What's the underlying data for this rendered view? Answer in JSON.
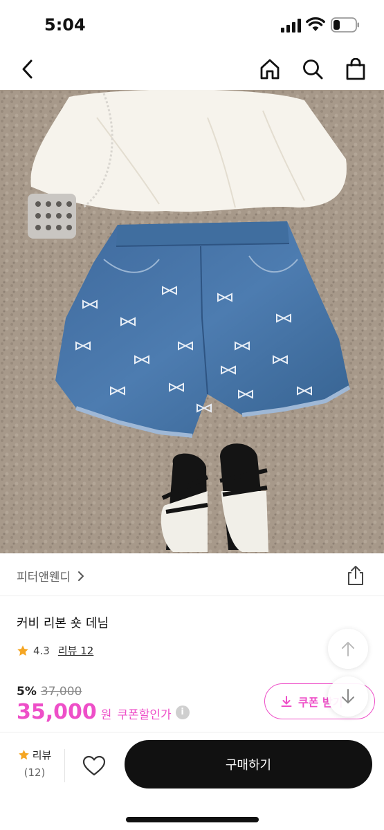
{
  "status_bar": {
    "time": "5:04"
  },
  "nav": {
    "back_icon": "chevron-left-icon",
    "home_icon": "home-icon",
    "search_icon": "search-icon",
    "cart_icon": "shopping-bag-icon"
  },
  "product": {
    "image": "photo of denim shorts with white bow embroidery, white blouse, beaded mini bag and black sandals on a carpet",
    "brand": "피터앤웬디",
    "title": "커비 리본 숏 데님",
    "rating": "4.3",
    "review_link": "리뷰 12",
    "discount_rate": "5%",
    "original_price": "37,000",
    "sale_price": "35,000",
    "currency": "원",
    "coupon_price_label": "쿠폰할인가",
    "coupon_button_label": "쿠폰 받기"
  },
  "bottom_bar": {
    "review_label": "리뷰",
    "review_count": "(12)",
    "buy_label": "구매하기"
  },
  "colors": {
    "accent": "#ee4fc8",
    "star": "#f5a623",
    "buy_button": "#111111"
  }
}
